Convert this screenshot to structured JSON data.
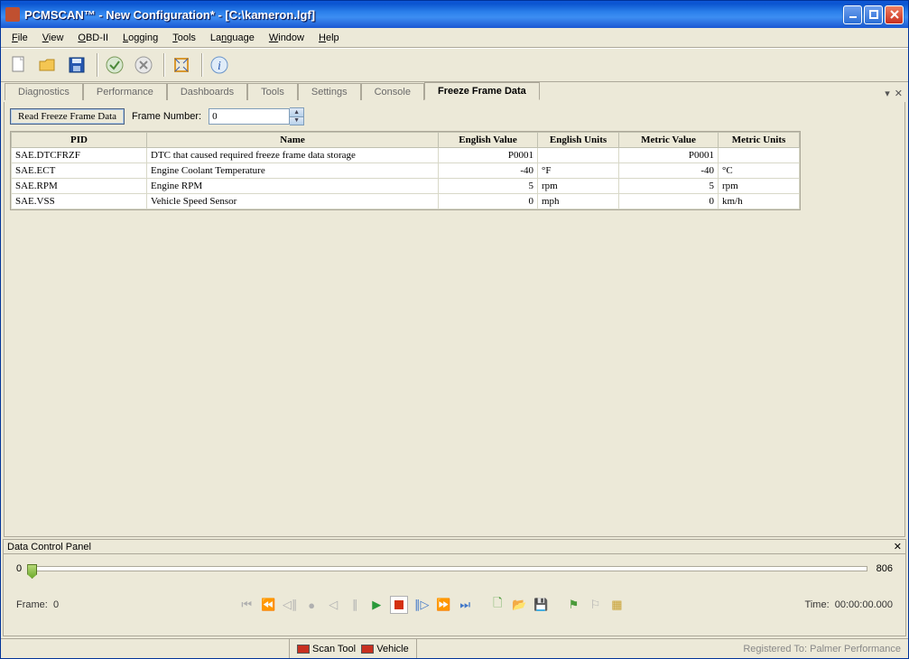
{
  "window": {
    "title": "PCMSCAN™ - New Configuration* - [C:\\kameron.lgf]"
  },
  "menu": {
    "items": [
      "File",
      "View",
      "OBD-II",
      "Logging",
      "Tools",
      "Language",
      "Window",
      "Help"
    ],
    "shortcuts": [
      "F",
      "V",
      "O",
      "L",
      "T",
      "n",
      "W",
      "H"
    ]
  },
  "tabs": {
    "items": [
      "Diagnostics",
      "Performance",
      "Dashboards",
      "Tools",
      "Settings",
      "Console",
      "Freeze Frame Data"
    ],
    "activeIndex": 6
  },
  "freezeFrame": {
    "read_btn": "Read Freeze Frame Data",
    "frame_label": "Frame Number:",
    "frame_value": "0",
    "columns": [
      "PID",
      "Name",
      "English Value",
      "English Units",
      "Metric Value",
      "Metric Units"
    ],
    "rows": [
      {
        "pid": "SAE.DTCFRZF",
        "name": "DTC that caused required freeze frame data storage",
        "ev": "P0001",
        "eu": "",
        "mv": "P0001",
        "mu": ""
      },
      {
        "pid": "SAE.ECT",
        "name": "Engine Coolant Temperature",
        "ev": "-40",
        "eu": "°F",
        "mv": "-40",
        "mu": "°C"
      },
      {
        "pid": "SAE.RPM",
        "name": "Engine RPM",
        "ev": "5",
        "eu": "rpm",
        "mv": "5",
        "mu": "rpm"
      },
      {
        "pid": "SAE.VSS",
        "name": "Vehicle Speed Sensor",
        "ev": "0",
        "eu": "mph",
        "mv": "0",
        "mu": "km/h"
      }
    ]
  },
  "dataPanel": {
    "title": "Data Control Panel",
    "min": "0",
    "max": "806",
    "frame_label": "Frame:",
    "frame_value": "0",
    "time_label": "Time:",
    "time_value": "00:00:00.000"
  },
  "status": {
    "scan_label": "Scan Tool",
    "vehicle_label": "Vehicle",
    "scan_color": "#c83020",
    "vehicle_color": "#c83020",
    "registered": "Registered To: Palmer Performance"
  }
}
